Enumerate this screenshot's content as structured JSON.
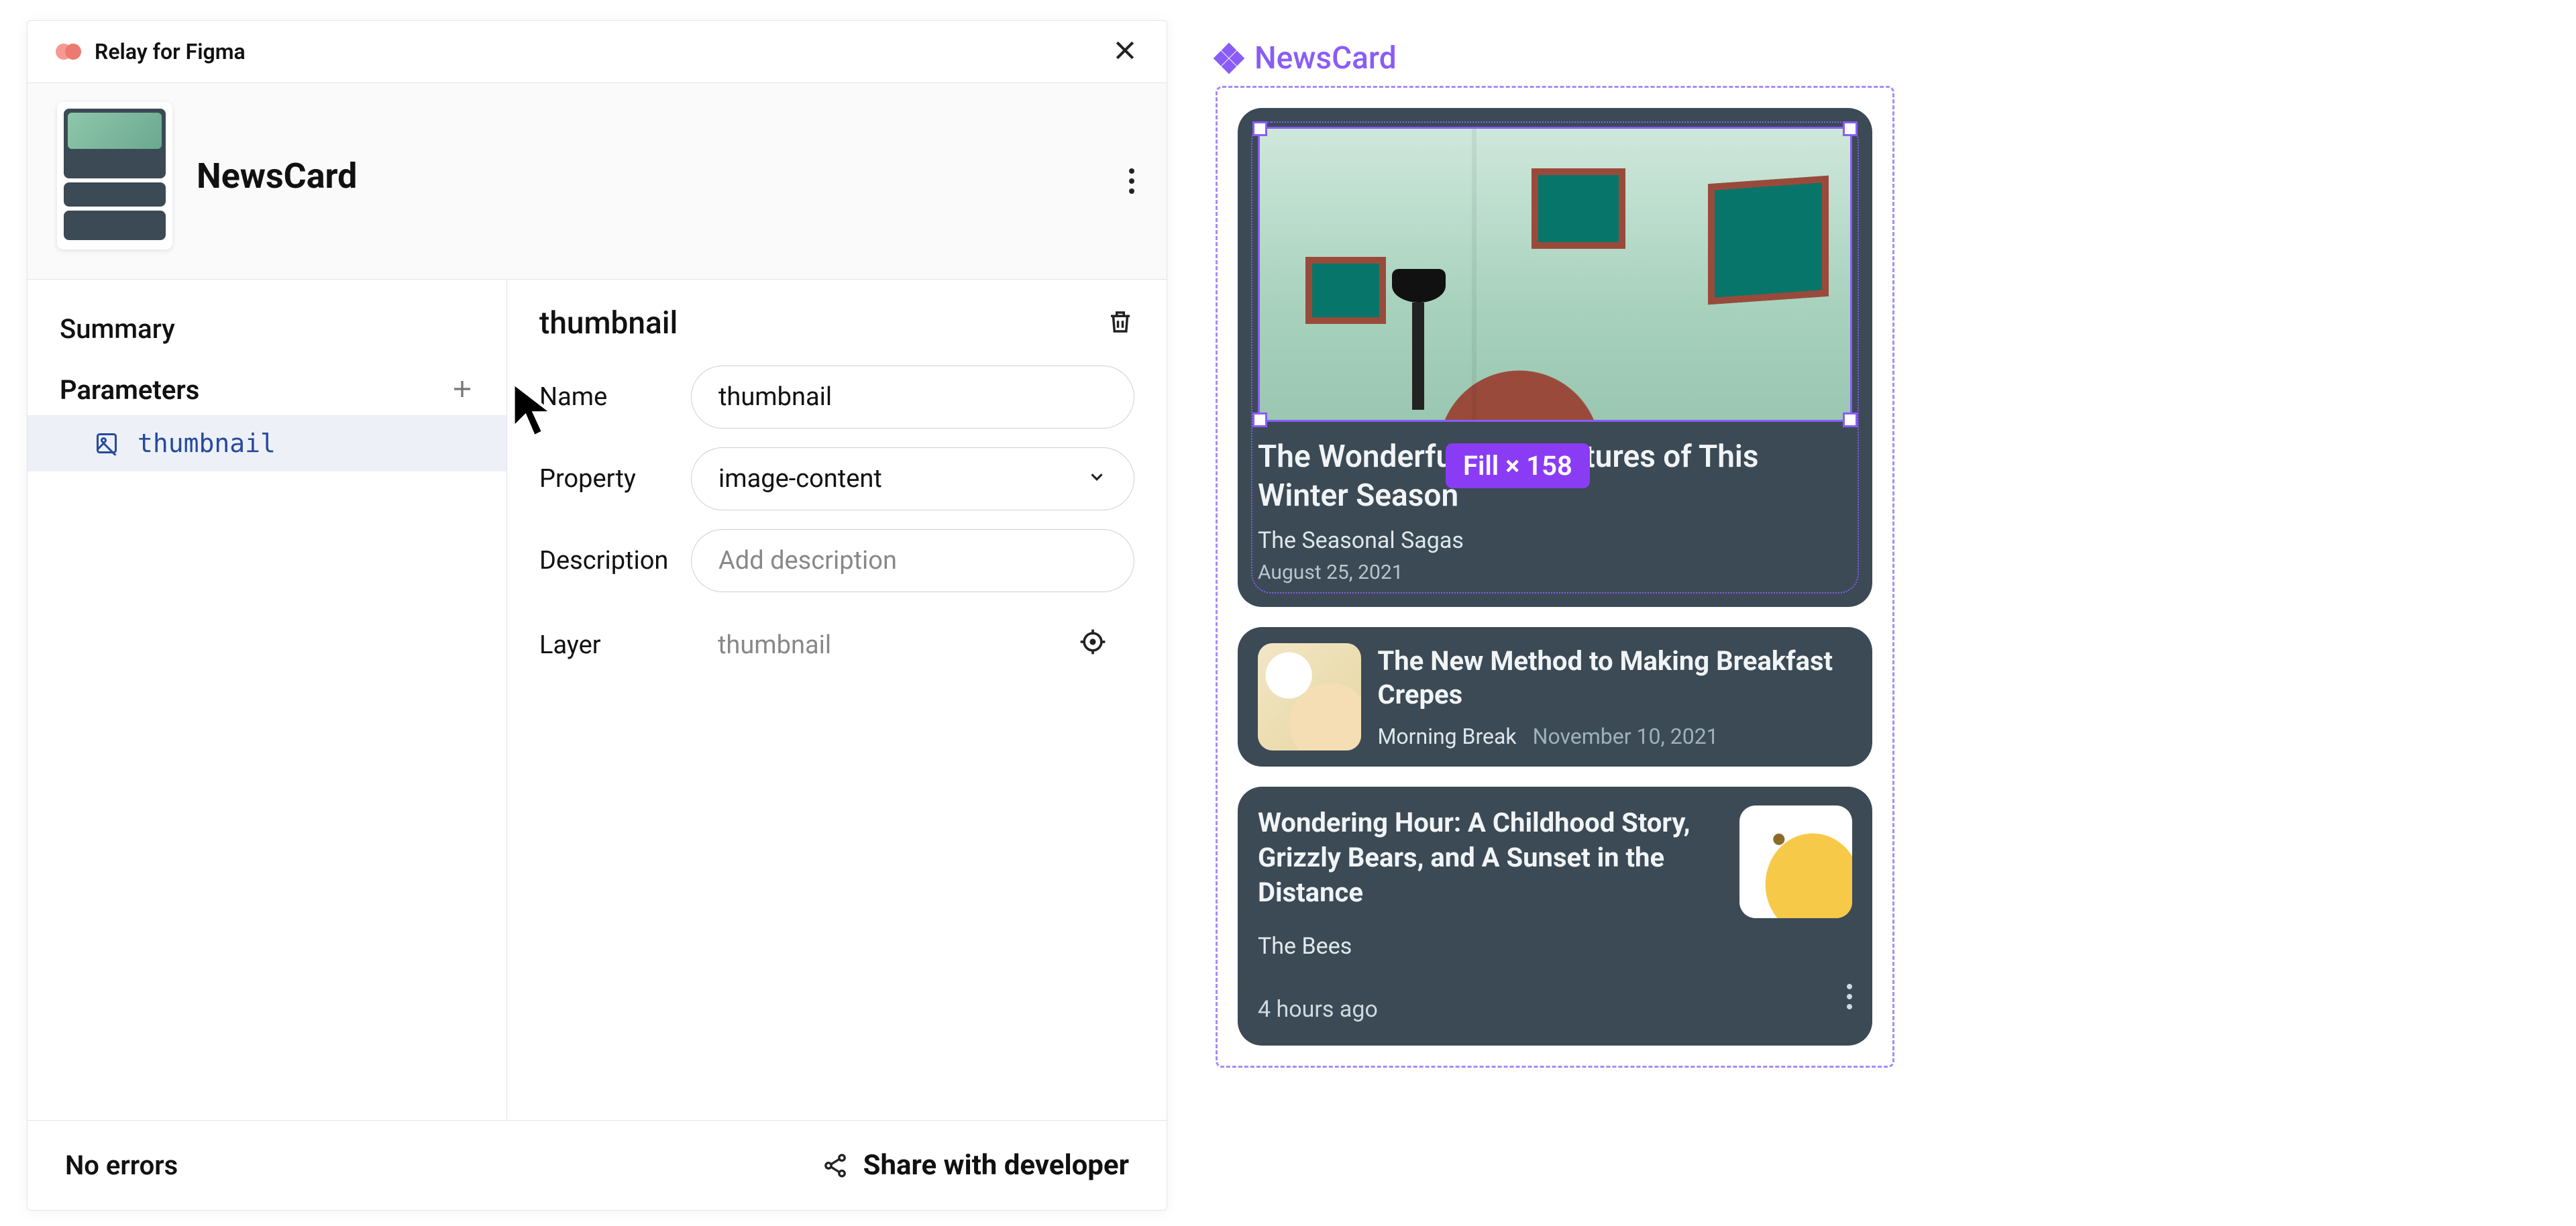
{
  "plugin": {
    "title": "Relay for Figma",
    "component_name": "NewsCard",
    "sidebar": {
      "summary_label": "Summary",
      "parameters_label": "Parameters",
      "param_item": "thumbnail"
    },
    "details": {
      "heading": "thumbnail",
      "name_label": "Name",
      "name_value": "thumbnail",
      "property_label": "Property",
      "property_value": "image-content",
      "description_label": "Description",
      "description_placeholder": "Add description",
      "layer_label": "Layer",
      "layer_value": "thumbnail"
    },
    "footer": {
      "status": "No errors",
      "share": "Share with developer"
    }
  },
  "canvas": {
    "frame_label": "NewsCard",
    "selection_badge": "Fill × 158",
    "cards": {
      "hero": {
        "title": "The Wonderful Architectures of This Winter Season",
        "source": "The Seasonal Sagas",
        "date": "August 25, 2021"
      },
      "row": {
        "title": "The New Method to Making Breakfast Crepes",
        "source": "Morning Break",
        "date": "November 10, 2021"
      },
      "big": {
        "title": "Wondering Hour: A Childhood Story, Grizzly Bears, and A Sunset in the Distance",
        "source": "The Bees",
        "ago": "4 hours ago"
      }
    }
  }
}
